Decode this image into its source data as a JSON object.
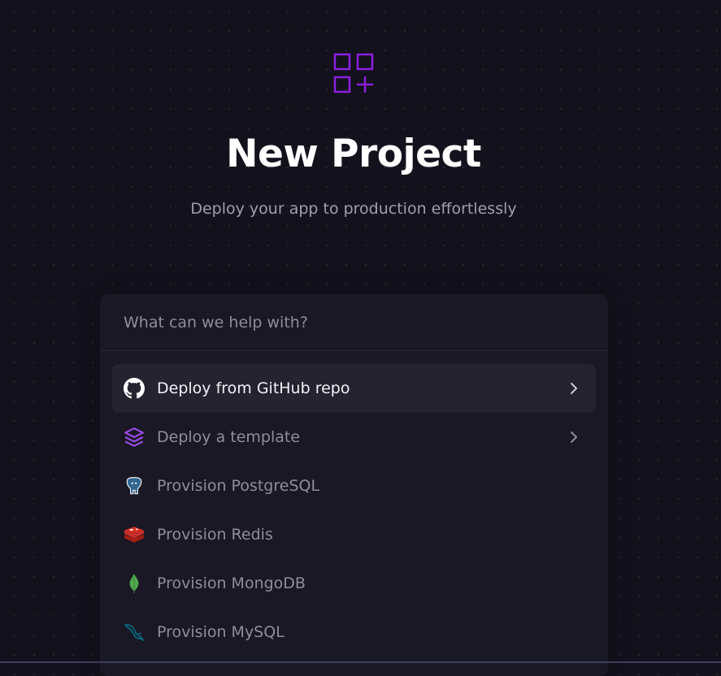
{
  "header": {
    "title": "New Project",
    "subtitle": "Deploy your app to production effortlessly",
    "logo_icon": "grid-plus-icon"
  },
  "search": {
    "placeholder": "What can we help with?",
    "value": ""
  },
  "menu": {
    "items": [
      {
        "label": "Deploy from GitHub repo",
        "icon": "github-icon",
        "has_chevron": true,
        "active": true
      },
      {
        "label": "Deploy a template",
        "icon": "layers-icon",
        "has_chevron": true,
        "active": false
      },
      {
        "label": "Provision PostgreSQL",
        "icon": "postgresql-icon",
        "has_chevron": false,
        "active": false
      },
      {
        "label": "Provision Redis",
        "icon": "redis-icon",
        "has_chevron": false,
        "active": false
      },
      {
        "label": "Provision MongoDB",
        "icon": "mongodb-icon",
        "has_chevron": false,
        "active": false
      },
      {
        "label": "Provision MySQL",
        "icon": "mysql-icon",
        "has_chevron": false,
        "active": false
      }
    ]
  },
  "colors": {
    "background": "#13111c",
    "panel": "#1a1824",
    "accent_purple": "#8a2be2",
    "active_row": "#252330"
  }
}
